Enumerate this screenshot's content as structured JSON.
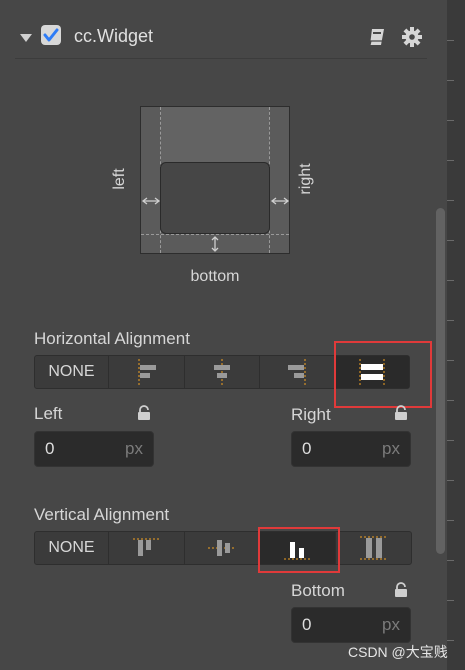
{
  "component": {
    "title": "cc.Widget",
    "checked": true
  },
  "icons": {
    "collapse": "triangle-down-icon",
    "checkbox": "checkbox-icon",
    "docs": "book-icon",
    "settings": "gear-icon",
    "lock": "lock-icon"
  },
  "preview": {
    "left_label": "left",
    "right_label": "right",
    "bottom_label": "bottom"
  },
  "horizontal": {
    "title": "Horizontal Alignment",
    "none_label": "NONE",
    "options": [
      "align-left-icon",
      "align-center-icon",
      "align-right-icon",
      "stretch-horizontal-icon"
    ],
    "selected_index": 4
  },
  "left_field": {
    "label": "Left",
    "value": "0",
    "unit": "px"
  },
  "right_field": {
    "label": "Right",
    "value": "0",
    "unit": "px"
  },
  "vertical": {
    "title": "Vertical Alignment",
    "none_label": "NONE",
    "options": [
      "align-top-icon",
      "align-middle-icon",
      "align-bottom-icon",
      "stretch-vertical-icon"
    ],
    "selected_index": 3
  },
  "bottom_field": {
    "label": "Bottom",
    "value": "0",
    "unit": "px"
  },
  "watermark": "CSDN @大宝贱",
  "colors": {
    "accent": "#2e7cf6",
    "highlight": "#e03a3a",
    "guide": "#f0a020"
  }
}
